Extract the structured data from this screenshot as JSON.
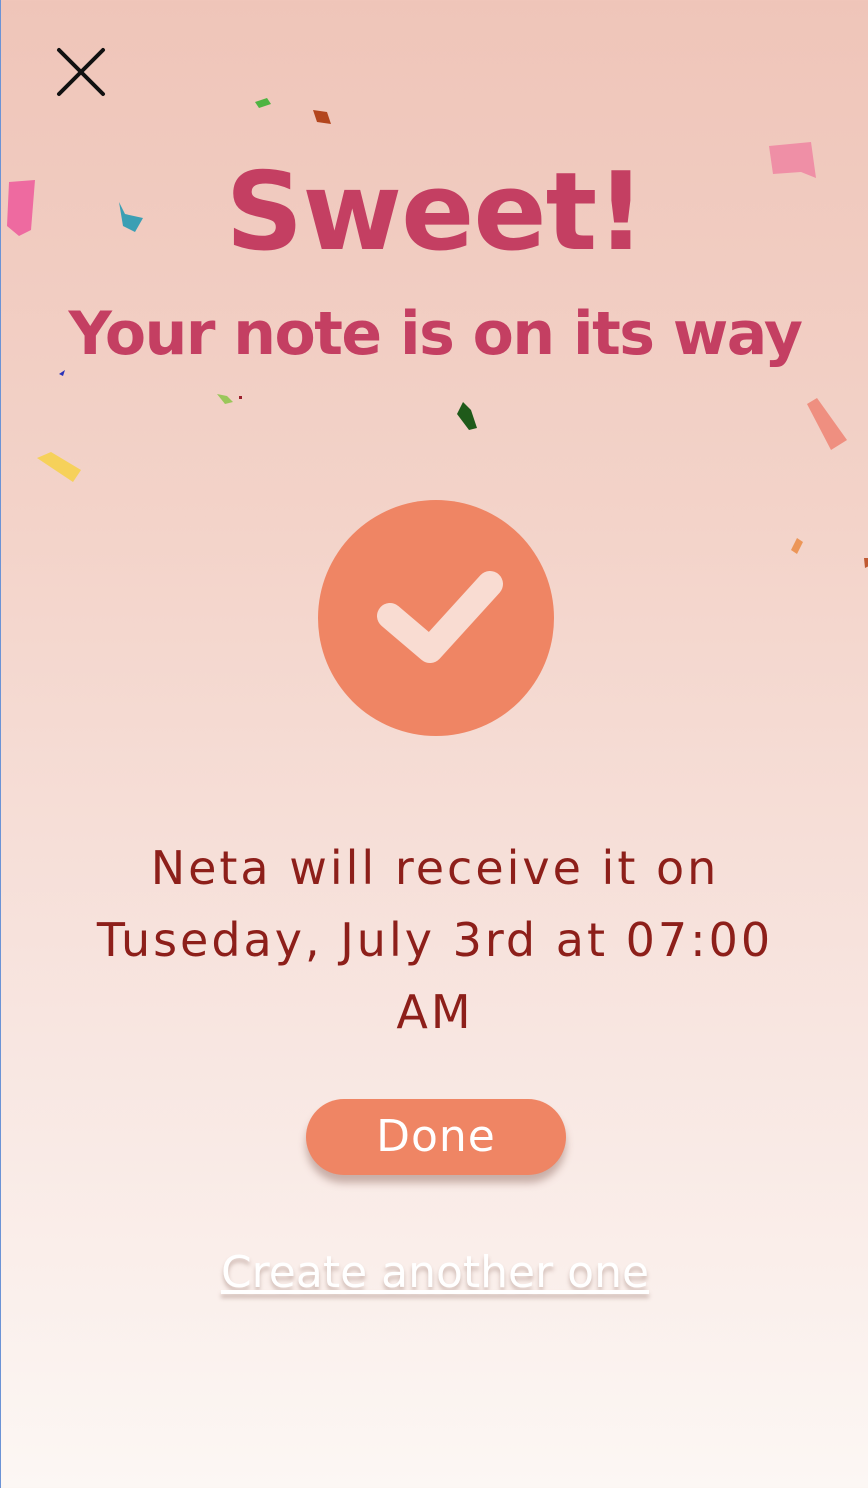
{
  "header": {
    "close_icon": "close-icon"
  },
  "confirmation": {
    "title": "Sweet!",
    "subtitle": "Your note is on its way",
    "status_icon": "checkmark-icon",
    "message_line1": "Neta will receive it on",
    "message_line2": "Tuseday, July 3rd at 07:00",
    "message_line3": "AM"
  },
  "actions": {
    "done_label": "Done",
    "create_another_label": "Create another one"
  },
  "colors": {
    "accent": "#ef8564",
    "title": "#c43f62",
    "message": "#8d1f1a",
    "background_top": "#efc5b9",
    "background_bottom": "#fcf7f4"
  }
}
